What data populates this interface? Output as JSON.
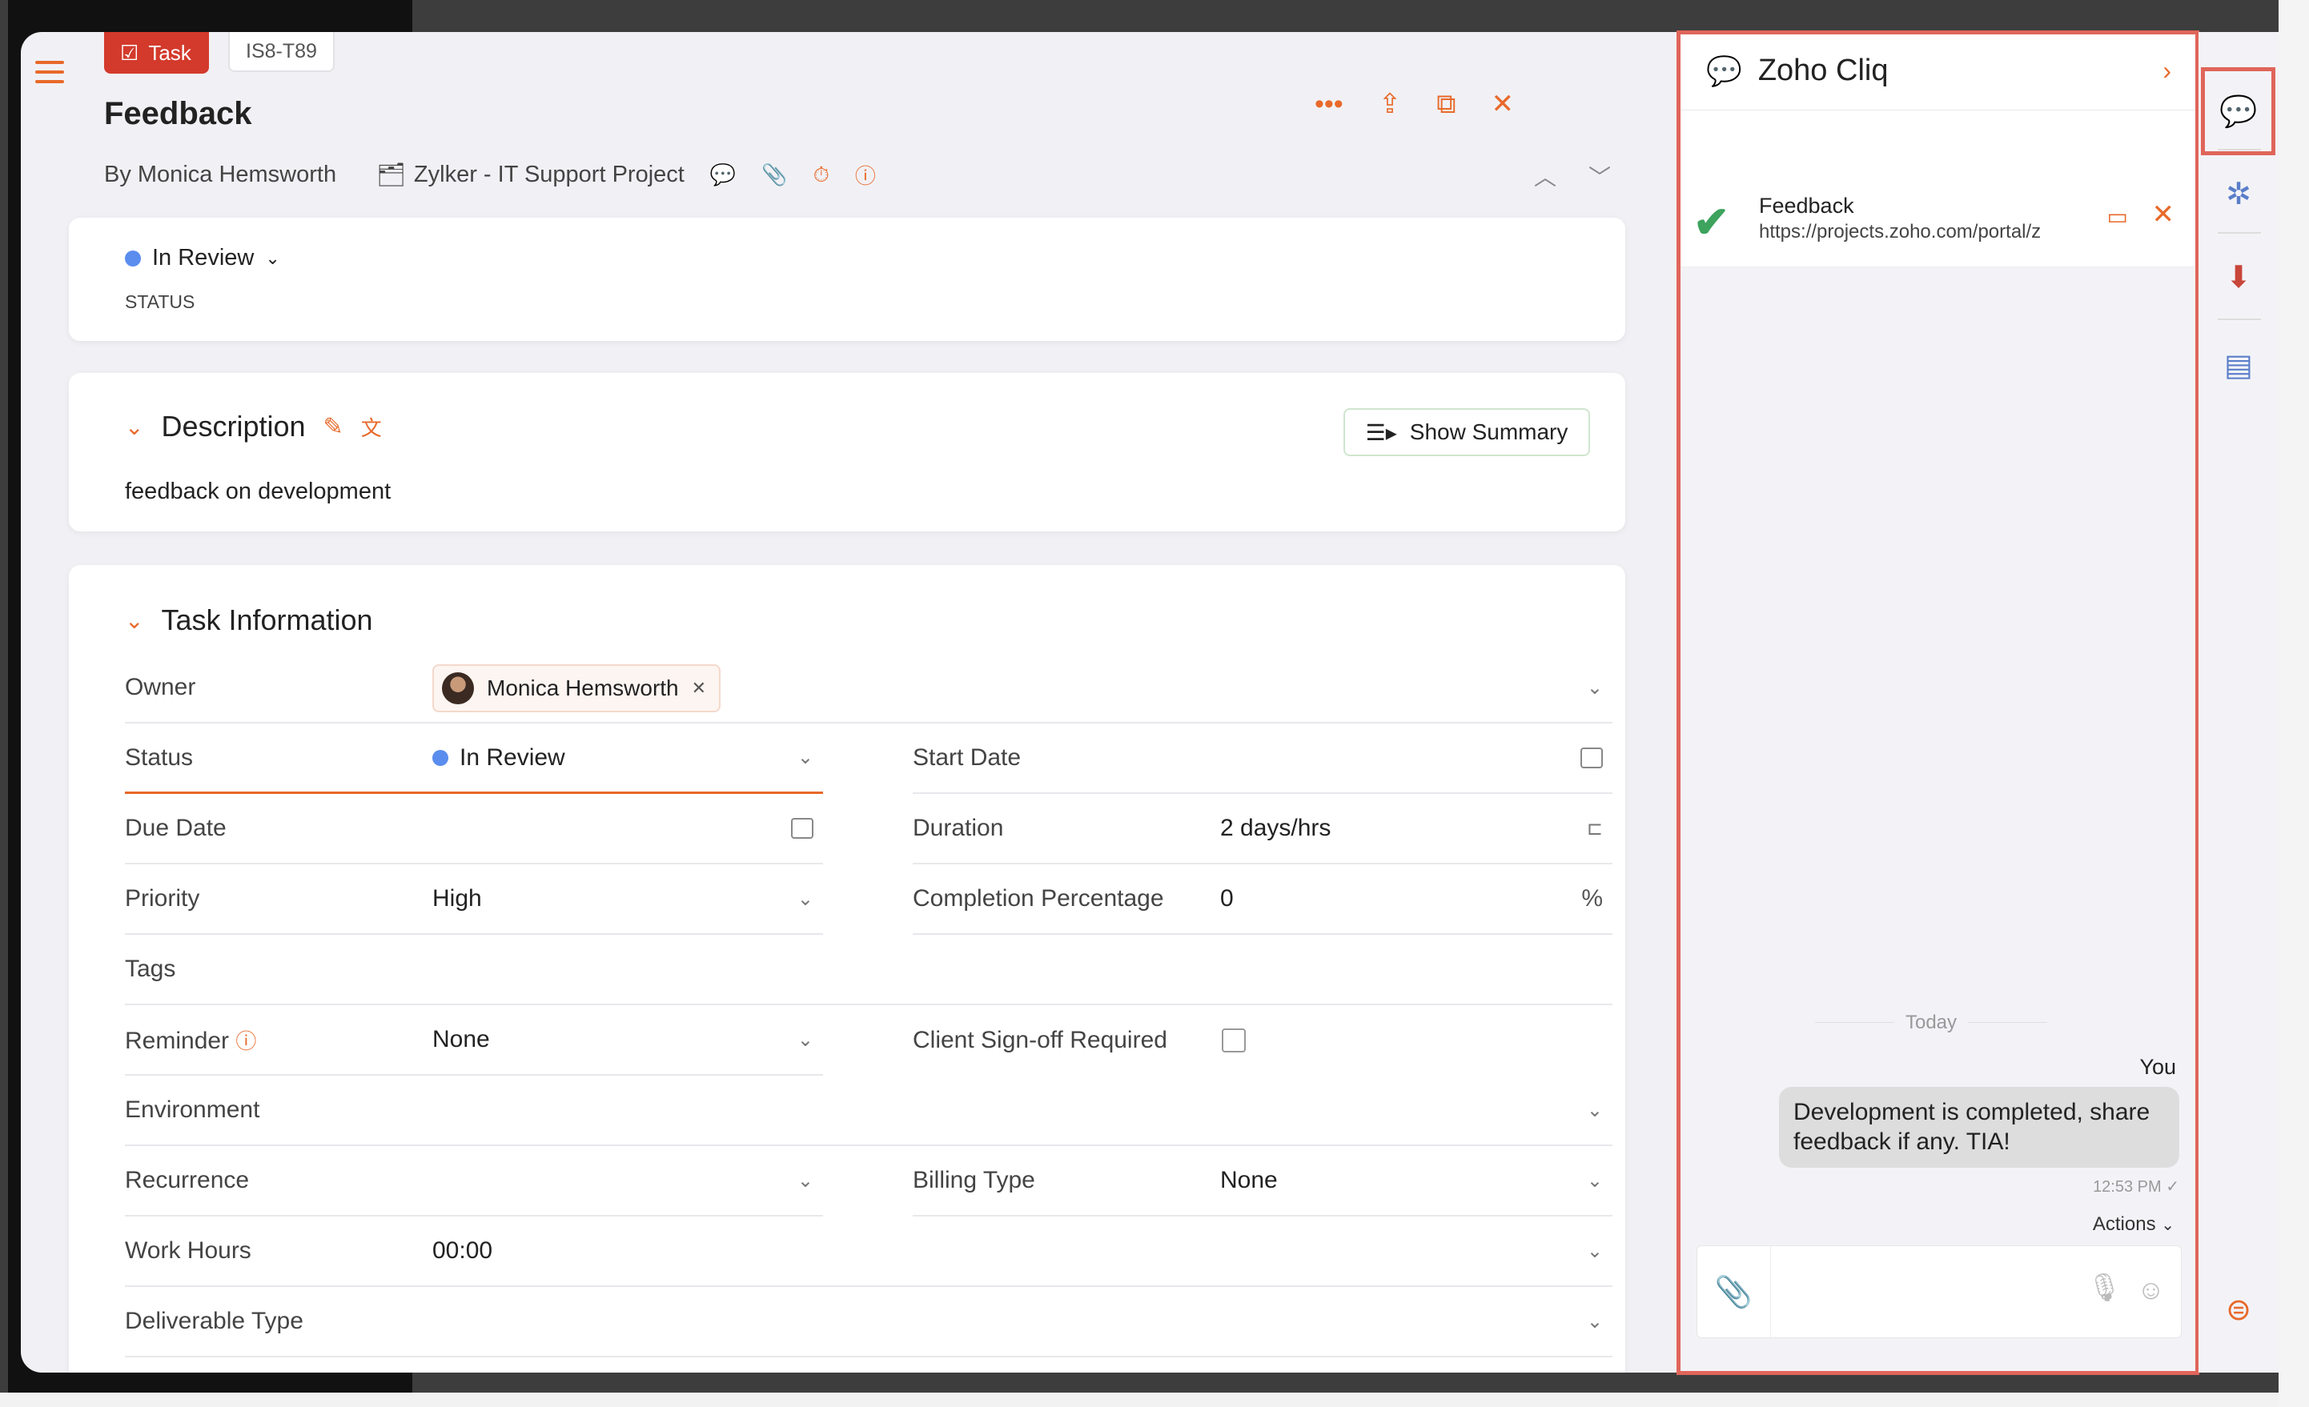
{
  "task": {
    "type_label": "Task",
    "id": "IS8-T89",
    "title": "Feedback",
    "author": "By Monica Hemsworth",
    "project": "Zylker - IT Support Project"
  },
  "status_card": {
    "value": "In Review",
    "label": "STATUS"
  },
  "description": {
    "heading": "Description",
    "text": "feedback on development",
    "summary_button": "Show Summary"
  },
  "task_info": {
    "heading": "Task Information",
    "owner_label": "Owner",
    "owner_value": "Monica Hemsworth",
    "status_label": "Status",
    "status_value": "In Review",
    "start_date_label": "Start Date",
    "due_date_label": "Due Date",
    "duration_label": "Duration",
    "duration_placeholder": "2 days/hrs",
    "priority_label": "Priority",
    "priority_value": "High",
    "completion_label": "Completion Percentage",
    "completion_value": "0",
    "completion_unit": "%",
    "tags_label": "Tags",
    "reminder_label": "Reminder",
    "reminder_value": "None",
    "signoff_label": "Client Sign-off Required",
    "environment_label": "Environment",
    "recurrence_label": "Recurrence",
    "billing_label": "Billing Type",
    "billing_value": "None",
    "work_hours_label": "Work Hours",
    "work_hours_value": "00:00",
    "deliverable_label": "Deliverable Type"
  },
  "chat": {
    "title": "Zoho Cliq",
    "context_title": "Feedback",
    "context_url": "https://projects.zoho.com/portal/z",
    "day_divider": "Today",
    "sender": "You",
    "message": "Development is completed, share feedback if any. TIA!",
    "timestamp": "12:53 PM",
    "actions_label": "Actions"
  },
  "colors": {
    "accent": "#e8692a",
    "task_tag": "#d33a2c",
    "status_dot": "#5b8def",
    "highlight_outline": "#e0655a"
  }
}
